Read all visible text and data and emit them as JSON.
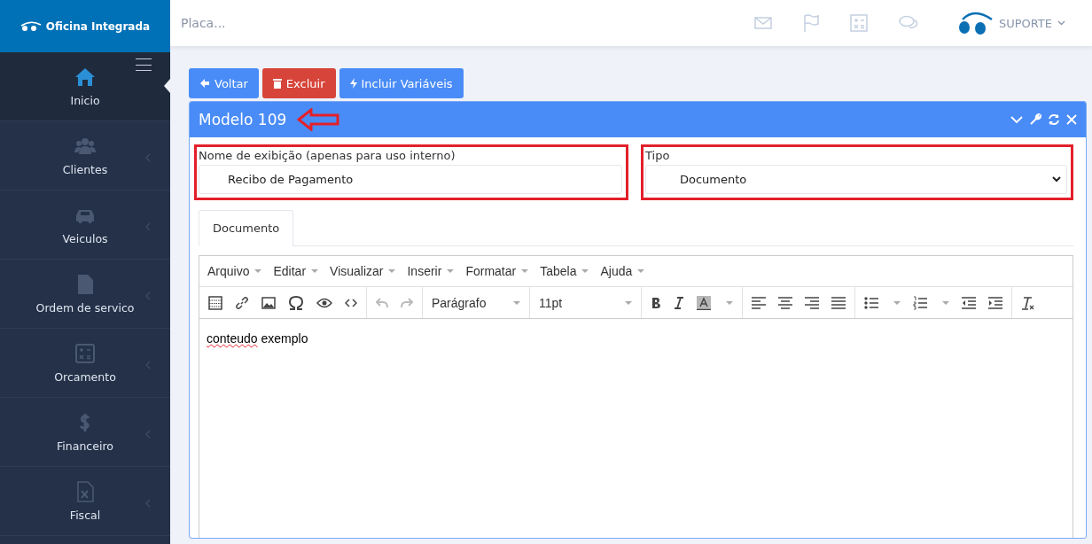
{
  "brand": {
    "name": "Oficina Integrada"
  },
  "search": {
    "placeholder": "Placa..."
  },
  "user": {
    "name": "SUPORTE"
  },
  "sidebar": {
    "items": [
      {
        "label": "Inicio",
        "kind": "home",
        "selected": true,
        "has_children": false
      },
      {
        "label": "Clientes",
        "kind": "users",
        "selected": false,
        "has_children": true
      },
      {
        "label": "Veiculos",
        "kind": "car",
        "selected": false,
        "has_children": true
      },
      {
        "label": "Ordem de servico",
        "kind": "file",
        "selected": false,
        "has_children": true
      },
      {
        "label": "Orcamento",
        "kind": "calc",
        "selected": false,
        "has_children": true
      },
      {
        "label": "Financeiro",
        "kind": "dollar",
        "selected": false,
        "has_children": true
      },
      {
        "label": "Fiscal",
        "kind": "xfile",
        "selected": false,
        "has_children": true
      }
    ]
  },
  "actions": [
    {
      "label": "Voltar",
      "kind": "back"
    },
    {
      "label": "Excluir",
      "kind": "delete"
    },
    {
      "label": "Incluir Variáveis",
      "kind": "vars"
    }
  ],
  "panel": {
    "title": "Modelo 109",
    "fields": [
      {
        "label": "Nome de exibição (apenas para uso interno)",
        "value": "Recibo de Pagamento",
        "kind": "text"
      },
      {
        "label": "Tipo",
        "value": "Documento",
        "kind": "select"
      }
    ],
    "tabs": [
      {
        "label": "Documento",
        "selected": true
      }
    ],
    "editor": {
      "menus": [
        "Arquivo",
        "Editar",
        "Visualizar",
        "Inserir",
        "Formatar",
        "Tabela",
        "Ajuda"
      ],
      "block_format": "Parágrafo",
      "font_size": "11pt",
      "content": [
        {
          "text": "conteudo",
          "misspelled": true
        },
        {
          "text": "exemplo",
          "misspelled": false
        }
      ]
    }
  }
}
